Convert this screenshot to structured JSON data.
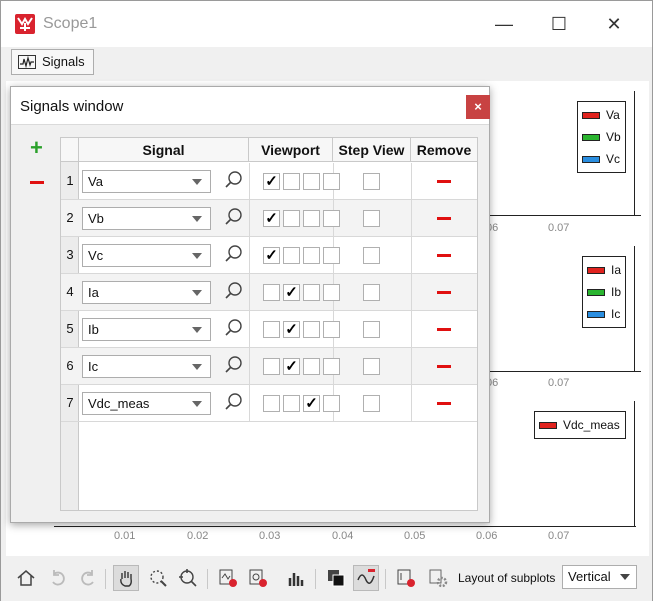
{
  "window": {
    "title": "Scope1",
    "minimize": "—",
    "maximize": "☐",
    "close": "✕"
  },
  "toolbar_top": {
    "signals_label": "Signals"
  },
  "plot": {
    "x_ticks": [
      "0.01",
      "0.02",
      "0.03",
      "0.04",
      "0.05",
      "0.06"
    ],
    "partial_ticks": [
      "06",
      "0.07"
    ],
    "legends": [
      {
        "entries": [
          {
            "name": "Va",
            "color": "#e0231e"
          },
          {
            "name": "Vb",
            "color": "#2bb530"
          },
          {
            "name": "Vc",
            "color": "#2a8ee0"
          }
        ]
      },
      {
        "entries": [
          {
            "name": "Ia",
            "color": "#e0231e"
          },
          {
            "name": "Ib",
            "color": "#2bb530"
          },
          {
            "name": "Ic",
            "color": "#2a8ee0"
          }
        ]
      },
      {
        "entries": [
          {
            "name": "Vdc_meas",
            "color": "#e0231e"
          }
        ]
      }
    ]
  },
  "signals_dialog": {
    "title": "Signals window",
    "close": "×",
    "add_symbol": "+",
    "columns": {
      "signal": "Signal",
      "viewport": "Viewport",
      "step_view": "Step View",
      "remove": "Remove"
    },
    "rows": [
      {
        "num": "1",
        "signal": "Va",
        "viewport": 1
      },
      {
        "num": "2",
        "signal": "Vb",
        "viewport": 1
      },
      {
        "num": "3",
        "signal": "Vc",
        "viewport": 1
      },
      {
        "num": "4",
        "signal": "Ia",
        "viewport": 2
      },
      {
        "num": "5",
        "signal": "Ib",
        "viewport": 2
      },
      {
        "num": "6",
        "signal": "Ic",
        "viewport": 2
      },
      {
        "num": "7",
        "signal": "Vdc_meas",
        "viewport": 3
      }
    ]
  },
  "bottom_toolbar": {
    "layout_label": "Layout of subplots",
    "layout_value": "Vertical",
    "icons": [
      "home-icon",
      "undo-icon",
      "redo-icon",
      "pan-hand-icon",
      "zoom-region-icon",
      "zoom-axis-icon",
      "export-signal-icon",
      "export-image-icon",
      "bar-chart-icon",
      "overlay-icon",
      "signal-toggle-icon",
      "cursor-settings-icon",
      "gear-icon"
    ]
  }
}
